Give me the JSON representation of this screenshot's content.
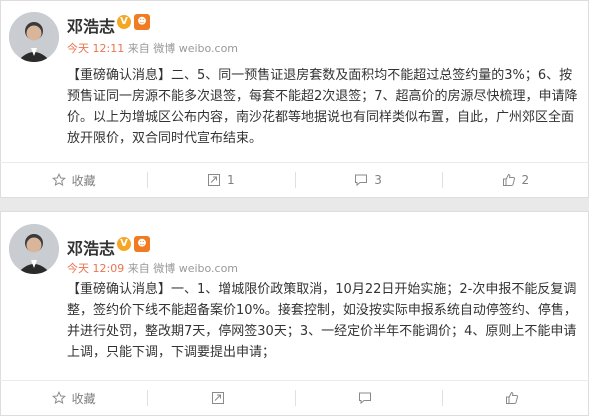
{
  "posts": [
    {
      "author": "邓浩志",
      "verified_badge": "V",
      "time": "今天 12:11",
      "source": "来自 微博 weibo.com",
      "text": "【重磅确认消息】二、5、同一预售证退房套数及面积均不能超过总签约量的3%；6、按预售证同一房源不能多次退签，每套不能超2次退签；7、超高价的房源尽快梳理，申请降价。以上为增城区公布内容，南沙花都等地据说也有同样类似布置，自此，广州郊区全面放开限价，双合同时代宣布结束。",
      "actions": {
        "favorite": "收藏",
        "repost": "1",
        "comment": "3",
        "like": "2"
      }
    },
    {
      "author": "邓浩志",
      "verified_badge": "V",
      "time": "今天 12:09",
      "source": "来自 微博 weibo.com",
      "text": "【重磅确认消息】一、1、增城限价政策取消，10月22日开始实施；2-次申报不能反复调整，签约价下线不能超备案价10%。接套控制，如没按实际申报系统自动停签约、停售，并进行处罚，整改期7天，停网签30天；3、一经定价半年不能调价；4、原则上不能申请上调，只能下调，下调要提出申请；",
      "actions": {
        "favorite": "收藏",
        "repost": "",
        "comment": "",
        "like": ""
      }
    }
  ],
  "colors": {
    "time_accent": "#eb7350",
    "badge": "#f5a623",
    "meta": "#999999",
    "action": "#808080"
  }
}
